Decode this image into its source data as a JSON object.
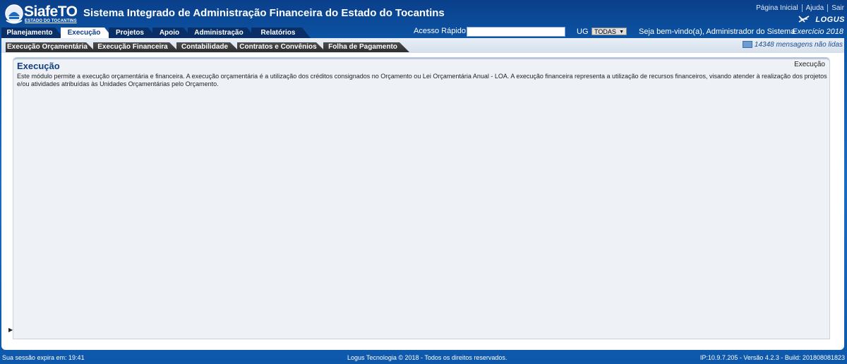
{
  "header": {
    "brand": "SiafeTO",
    "brand_sub": "ESTADO DO TOCANTINS",
    "title": "Sistema Integrado de Administração Financeira do Estado do Tocantins",
    "links": [
      "Página Inicial",
      "Ajuda",
      "Sair"
    ],
    "vendor": "LOGUS"
  },
  "main_nav": {
    "tabs": [
      "Planejamento",
      "Execução",
      "Projetos",
      "Apoio",
      "Administração",
      "Relatórios"
    ],
    "active": "Execução"
  },
  "toolbar": {
    "quick_access_label": "Acesso Rápido",
    "quick_access_value": "",
    "ug_label": "UG",
    "ug_selected": "TODAS",
    "welcome": "Seja bem-vindo(a), Administrador do Sistema",
    "exercise": "Exercício 2018"
  },
  "sub_nav": {
    "tabs": [
      "Execução Orçamentária",
      "Execução Financeira",
      "Contabilidade",
      "Contratos e Convênios",
      "Folha de Pagamento"
    ]
  },
  "messages": {
    "text": "14348 mensagens não lidas"
  },
  "content": {
    "title": "Execução",
    "breadcrumb": "Execução",
    "description": "Este módulo permite a execução orçamentária e financeira. A execução orçamentária é a utilização dos créditos consignados no Orçamento ou Lei Orçamentária Anual - LOA. A execução financeira representa a utilização de recursos financeiros, visando atender à realização dos projetos e/ou atividades atribuídas às Unidades Orçamentárias pelo Orçamento."
  },
  "footer": {
    "session": "Sua sessão expira em: 19:41",
    "copyright": "Logus Tecnologia © 2018 - Todos os direitos reservados.",
    "build": "IP:10.9.7.205 - Versão 4.2.3 - Build: 201808081823"
  },
  "colors": {
    "primary": "#0c56a8",
    "dark_tab": "#0a2f66",
    "title": "#123f80"
  }
}
